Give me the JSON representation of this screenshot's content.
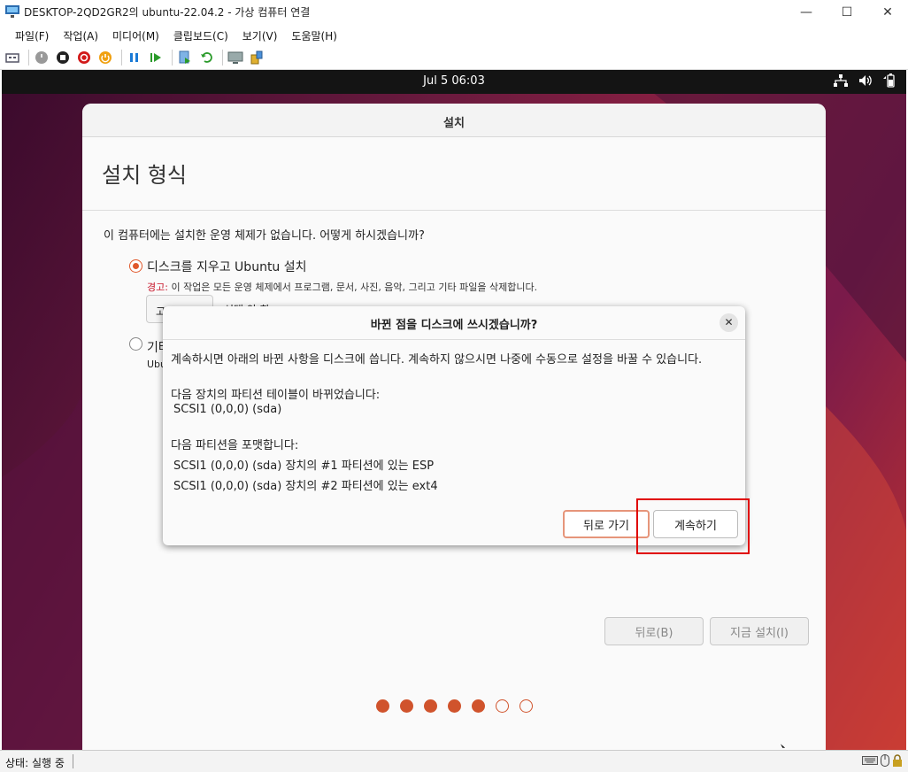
{
  "window": {
    "title": "DESKTOP-2QD2GR2의 ubuntu-22.04.2 - 가상 컴퓨터 연결",
    "minimize_icon": "minimize-icon",
    "maximize_icon": "maximize-icon",
    "close_icon": "close-icon"
  },
  "menubar": {
    "items": [
      "파일(F)",
      "작업(A)",
      "미디어(M)",
      "클립보드(C)",
      "보기(V)",
      "도움말(H)"
    ]
  },
  "toolbar": {
    "icons": [
      "ctrl-alt-del-icon",
      "start-icon",
      "turn-off-icon",
      "shut-down-icon",
      "save-icon",
      "pause-icon",
      "resume-icon",
      "checkpoint-icon",
      "revert-icon",
      "enhanced-session-icon",
      "share-icon"
    ]
  },
  "guest": {
    "topbar": {
      "clock": "Jul 5  06:03"
    },
    "installer": {
      "window_title": "설치",
      "heading": "설치 형식",
      "question": "이 컴퓨터에는 설치한 운영 체제가 없습니다. 어떻게 하시겠습니까?",
      "option_erase": "디스크를 지우고 Ubuntu 설치",
      "warning_label": "경고:",
      "warning_text": " 이 작업은 모든 운영 체제에서 프로그램, 문서, 사진, 음악, 그리고 기타 파일을 삭제합니다.",
      "advanced_button_peek": "고급 기능...",
      "advanced_status_peek": "선택 안 함",
      "option_other_peek": "기타",
      "option_other_desc_peek": "Ubu",
      "back_button": "뒤로(B)",
      "install_button": "지금 설치(I)",
      "progress": {
        "total": 7,
        "done": 5
      }
    },
    "dialog": {
      "title": "바뀐 점을 디스크에 쓰시겠습니까?",
      "intro": "계속하시면 아래의 바뀐 사항을 디스크에 씁니다. 계속하지 않으시면 나중에 수동으로 설정을 바꿀 수 있습니다.",
      "table_heading": "다음 장치의 파티션 테이블이 바뀌었습니다:",
      "table_device": "SCSI1 (0,0,0) (sda)",
      "format_heading": "다음 파티션을 포맷합니다:",
      "format_items": [
        "SCSI1 (0,0,0) (sda) 장치의 #1 파티션에 있는 ESP",
        "SCSI1 (0,0,0) (sda) 장치의 #2 파티션에 있는 ext4"
      ],
      "back_button": "뒤로 가기",
      "continue_button": "계속하기"
    }
  },
  "statusbar": {
    "text": "상태: 실행 중"
  },
  "colors": {
    "accent": "#E95420",
    "highlight": "#E00000",
    "topbar": "#141414"
  }
}
